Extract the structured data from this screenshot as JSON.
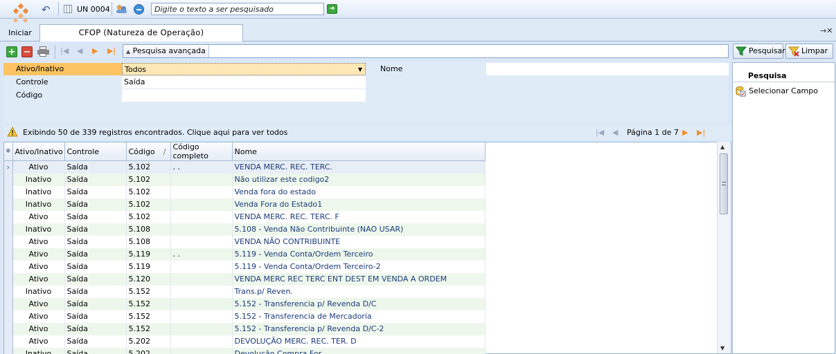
{
  "topbar": {
    "un_label": "UN 0004",
    "search_placeholder": "Digite o texto a ser pesquisado",
    "iniciar": "Iniciar"
  },
  "tab": {
    "label": "CFOP (Natureza de Operação)",
    "controls": "→✕"
  },
  "toolbar": {
    "advanced_search": "Pesquisa avançada",
    "pesquisar": "Pesquisar",
    "limpar": "Limpar"
  },
  "filters": {
    "ativo_label": "Ativo/Inativo",
    "ativo_value": "Todos",
    "controle_label": "Controle",
    "controle_value": "Saída",
    "codigo_label": "Código",
    "codigo_value": "",
    "nome_label": "Nome",
    "nome_value": ""
  },
  "status": {
    "message": "Exibindo 50 de 339 registros encontrados. Clique aqui para ver todos",
    "page": "Página 1 de 7"
  },
  "grid": {
    "headers": [
      "Ativo/Inativo",
      "Controle",
      "Código",
      "Código completo",
      "Nome"
    ],
    "rows": [
      [
        "Ativo",
        "Saída",
        "5.102",
        ".  .",
        "VENDA MERC. REC. TERC."
      ],
      [
        "Inativo",
        "Saída",
        "5.102",
        "",
        "Não utilizar este codigo2"
      ],
      [
        "Inativo",
        "Saída",
        "5.102",
        "",
        "Venda fora do estado"
      ],
      [
        "Inativo",
        "Saída",
        "5.102",
        "",
        "Venda Fora do Estado1"
      ],
      [
        "Ativo",
        "Saída",
        "5.102",
        "",
        "VENDA MERC. REC. TERC. F"
      ],
      [
        "Inativo",
        "Saída",
        "5.108",
        "",
        "5.108 - Venda Não Contribuinte (NAO USAR)"
      ],
      [
        "Ativo",
        "Saída",
        "5.108",
        "",
        "VENDA NÃO CONTRIBUINTE"
      ],
      [
        "Ativo",
        "Saída",
        "5.119",
        ".  .",
        "5.119 - Venda Conta/Ordem Terceiro"
      ],
      [
        "Ativo",
        "Saída",
        "5.119",
        "",
        "5.119 - Venda Conta/Ordem Terceiro-2"
      ],
      [
        "Ativo",
        "Saída",
        "5.120",
        "",
        "VENDA MERC REC TERC ENT DEST EM VENDA A ORDEM"
      ],
      [
        "Inativo",
        "Saída",
        "5.152",
        "",
        "Trans.p/ Reven."
      ],
      [
        "Ativo",
        "Saída",
        "5.152",
        "",
        "5.152 - Transferencia p/ Revenda D/C"
      ],
      [
        "Ativo",
        "Saída",
        "5.152",
        "",
        "5.152 - Transferencia de Mercadoria"
      ],
      [
        "Ativo",
        "Saída",
        "5.152",
        "",
        "5.152 - Transferencia p/ Revenda D/C-2"
      ],
      [
        "Ativo",
        "Saída",
        "5.202",
        "",
        "DEVOLUÇÃO MERC. REC. TER. D"
      ],
      [
        "Inativo",
        "Saída",
        "5.202",
        "",
        "Devolução Compra For"
      ]
    ]
  },
  "right_panel": {
    "title": "Pesquisa",
    "item": "Selecionar Campo"
  }
}
